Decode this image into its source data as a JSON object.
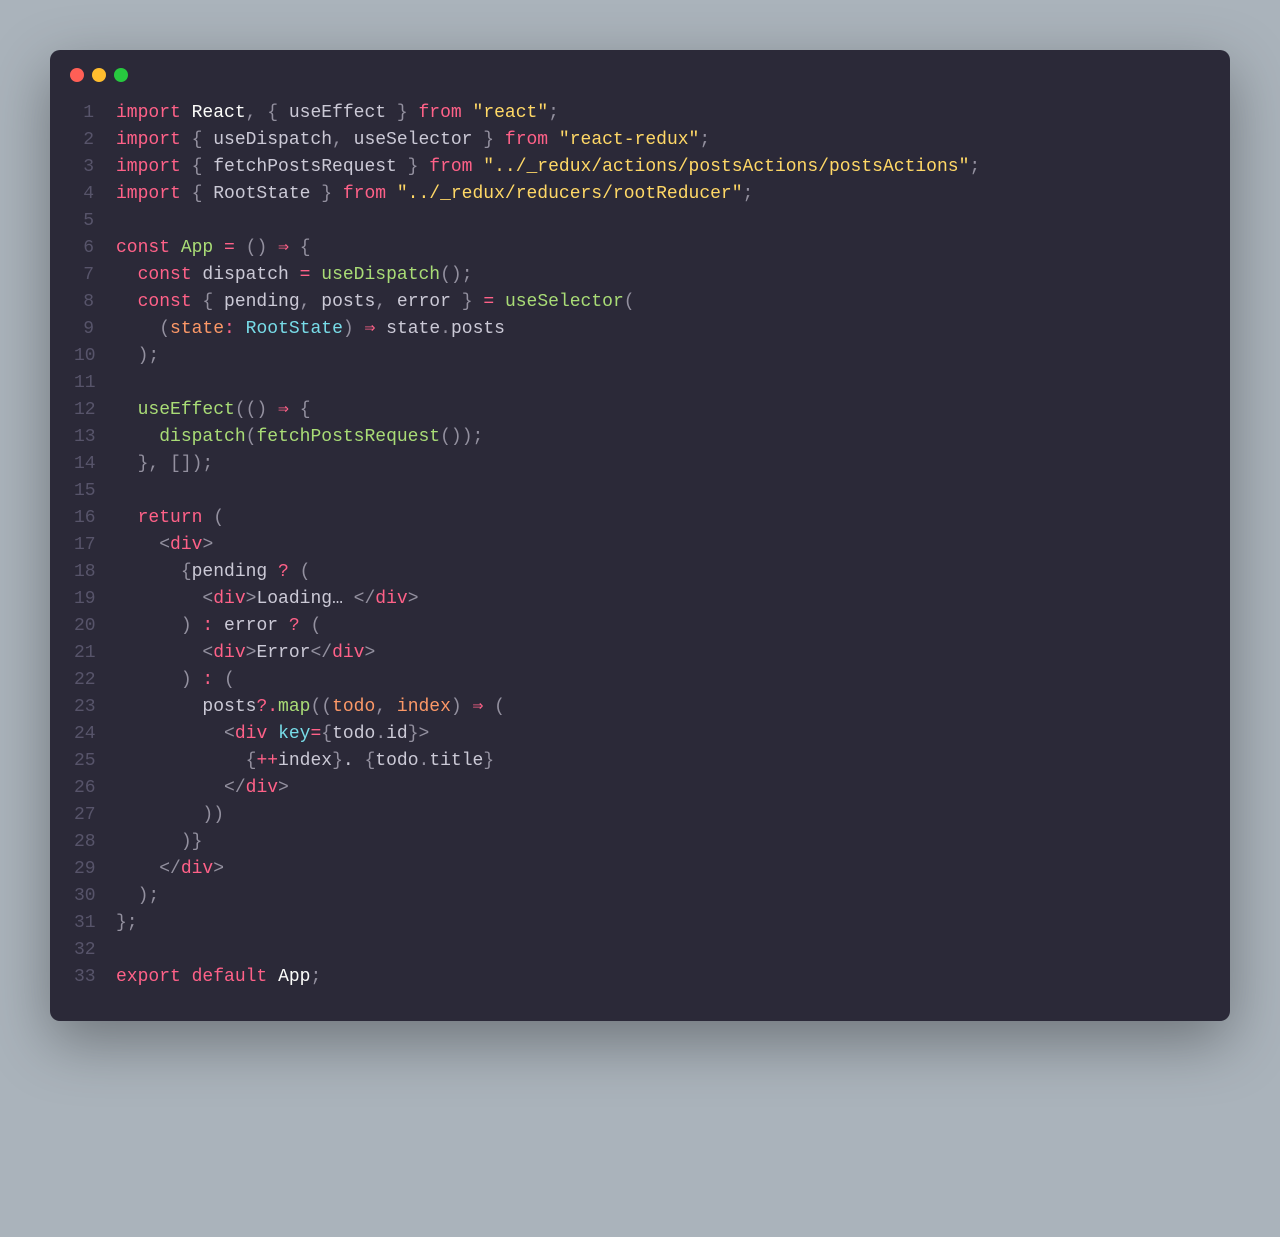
{
  "window": {
    "dots": [
      "red",
      "yellow",
      "green"
    ]
  },
  "colors": {
    "background": "#aab3bb",
    "editor_bg": "#2b2938",
    "gutter": "#57546a",
    "keyword": "#ff6188",
    "string": "#ffd866",
    "func": "#a9dc76",
    "type": "#78dce8",
    "param": "#fc9867",
    "default": "#cbc9d6",
    "punct": "#93909f",
    "white": "#fcfcfa"
  },
  "code": {
    "line_count": 33,
    "lines": [
      {
        "n": 1,
        "tokens": [
          [
            "keyword",
            "import"
          ],
          [
            "default",
            " "
          ],
          [
            "white",
            "React"
          ],
          [
            "punct",
            ", { "
          ],
          [
            "default",
            "useEffect"
          ],
          [
            "punct",
            " } "
          ],
          [
            "keyword",
            "from"
          ],
          [
            "default",
            " "
          ],
          [
            "string",
            "\"react\""
          ],
          [
            "punct",
            ";"
          ]
        ]
      },
      {
        "n": 2,
        "tokens": [
          [
            "keyword",
            "import"
          ],
          [
            "punct",
            " { "
          ],
          [
            "default",
            "useDispatch"
          ],
          [
            "punct",
            ", "
          ],
          [
            "default",
            "useSelector"
          ],
          [
            "punct",
            " } "
          ],
          [
            "keyword",
            "from"
          ],
          [
            "default",
            " "
          ],
          [
            "string",
            "\"react-redux\""
          ],
          [
            "punct",
            ";"
          ]
        ]
      },
      {
        "n": 3,
        "tokens": [
          [
            "keyword",
            "import"
          ],
          [
            "punct",
            " { "
          ],
          [
            "default",
            "fetchPostsRequest"
          ],
          [
            "punct",
            " } "
          ],
          [
            "keyword",
            "from"
          ],
          [
            "default",
            " "
          ],
          [
            "string",
            "\"../_redux/actions/postsActions/postsActions\""
          ],
          [
            "punct",
            ";"
          ]
        ]
      },
      {
        "n": 4,
        "tokens": [
          [
            "keyword",
            "import"
          ],
          [
            "punct",
            " { "
          ],
          [
            "default",
            "RootState"
          ],
          [
            "punct",
            " } "
          ],
          [
            "keyword",
            "from"
          ],
          [
            "default",
            " "
          ],
          [
            "string",
            "\"../_redux/reducers/rootReducer\""
          ],
          [
            "punct",
            ";"
          ]
        ]
      },
      {
        "n": 5,
        "tokens": []
      },
      {
        "n": 6,
        "tokens": [
          [
            "keyword",
            "const"
          ],
          [
            "default",
            " "
          ],
          [
            "func",
            "App"
          ],
          [
            "default",
            " "
          ],
          [
            "op",
            "="
          ],
          [
            "default",
            " "
          ],
          [
            "punct",
            "() "
          ],
          [
            "keyword",
            "⇒"
          ],
          [
            "default",
            " "
          ],
          [
            "punct",
            "{"
          ]
        ]
      },
      {
        "n": 7,
        "tokens": [
          [
            "default",
            "  "
          ],
          [
            "keyword",
            "const"
          ],
          [
            "default",
            " dispatch "
          ],
          [
            "op",
            "="
          ],
          [
            "default",
            " "
          ],
          [
            "func",
            "useDispatch"
          ],
          [
            "punct",
            "();"
          ]
        ]
      },
      {
        "n": 8,
        "tokens": [
          [
            "default",
            "  "
          ],
          [
            "keyword",
            "const"
          ],
          [
            "punct",
            " { "
          ],
          [
            "default",
            "pending"
          ],
          [
            "punct",
            ", "
          ],
          [
            "default",
            "posts"
          ],
          [
            "punct",
            ", "
          ],
          [
            "default",
            "error"
          ],
          [
            "punct",
            " } "
          ],
          [
            "op",
            "="
          ],
          [
            "default",
            " "
          ],
          [
            "func",
            "useSelector"
          ],
          [
            "punct",
            "("
          ]
        ]
      },
      {
        "n": 9,
        "tokens": [
          [
            "default",
            "    "
          ],
          [
            "punct",
            "("
          ],
          [
            "param",
            "state"
          ],
          [
            "op",
            ":"
          ],
          [
            "default",
            " "
          ],
          [
            "type",
            "RootState"
          ],
          [
            "punct",
            ") "
          ],
          [
            "keyword",
            "⇒"
          ],
          [
            "default",
            " state"
          ],
          [
            "punct",
            "."
          ],
          [
            "default",
            "posts"
          ]
        ]
      },
      {
        "n": 10,
        "tokens": [
          [
            "default",
            "  "
          ],
          [
            "punct",
            ");"
          ]
        ]
      },
      {
        "n": 11,
        "tokens": []
      },
      {
        "n": 12,
        "tokens": [
          [
            "default",
            "  "
          ],
          [
            "func",
            "useEffect"
          ],
          [
            "punct",
            "(() "
          ],
          [
            "keyword",
            "⇒"
          ],
          [
            "punct",
            " {"
          ]
        ]
      },
      {
        "n": 13,
        "tokens": [
          [
            "default",
            "    "
          ],
          [
            "func",
            "dispatch"
          ],
          [
            "punct",
            "("
          ],
          [
            "func",
            "fetchPostsRequest"
          ],
          [
            "punct",
            "());"
          ]
        ]
      },
      {
        "n": 14,
        "tokens": [
          [
            "default",
            "  "
          ],
          [
            "punct",
            "}, []);"
          ]
        ]
      },
      {
        "n": 15,
        "tokens": []
      },
      {
        "n": 16,
        "tokens": [
          [
            "default",
            "  "
          ],
          [
            "keyword",
            "return"
          ],
          [
            "default",
            " "
          ],
          [
            "punct",
            "("
          ]
        ]
      },
      {
        "n": 17,
        "tokens": [
          [
            "default",
            "    "
          ],
          [
            "punct",
            "<"
          ],
          [
            "keyword",
            "div"
          ],
          [
            "punct",
            ">"
          ]
        ]
      },
      {
        "n": 18,
        "tokens": [
          [
            "default",
            "      "
          ],
          [
            "punct",
            "{"
          ],
          [
            "default",
            "pending "
          ],
          [
            "op",
            "?"
          ],
          [
            "default",
            " "
          ],
          [
            "punct",
            "("
          ]
        ]
      },
      {
        "n": 19,
        "tokens": [
          [
            "default",
            "        "
          ],
          [
            "punct",
            "<"
          ],
          [
            "keyword",
            "div"
          ],
          [
            "punct",
            ">"
          ],
          [
            "default",
            "Loading… "
          ],
          [
            "punct",
            "</"
          ],
          [
            "keyword",
            "div"
          ],
          [
            "punct",
            ">"
          ]
        ]
      },
      {
        "n": 20,
        "tokens": [
          [
            "default",
            "      "
          ],
          [
            "punct",
            ") "
          ],
          [
            "op",
            ":"
          ],
          [
            "default",
            " error "
          ],
          [
            "op",
            "?"
          ],
          [
            "default",
            " "
          ],
          [
            "punct",
            "("
          ]
        ]
      },
      {
        "n": 21,
        "tokens": [
          [
            "default",
            "        "
          ],
          [
            "punct",
            "<"
          ],
          [
            "keyword",
            "div"
          ],
          [
            "punct",
            ">"
          ],
          [
            "default",
            "Error"
          ],
          [
            "punct",
            "</"
          ],
          [
            "keyword",
            "div"
          ],
          [
            "punct",
            ">"
          ]
        ]
      },
      {
        "n": 22,
        "tokens": [
          [
            "default",
            "      "
          ],
          [
            "punct",
            ") "
          ],
          [
            "op",
            ":"
          ],
          [
            "default",
            " "
          ],
          [
            "punct",
            "("
          ]
        ]
      },
      {
        "n": 23,
        "tokens": [
          [
            "default",
            "        posts"
          ],
          [
            "op",
            "?."
          ],
          [
            "func",
            "map"
          ],
          [
            "punct",
            "(("
          ],
          [
            "param",
            "todo"
          ],
          [
            "punct",
            ", "
          ],
          [
            "param",
            "index"
          ],
          [
            "punct",
            ") "
          ],
          [
            "keyword",
            "⇒"
          ],
          [
            "default",
            " "
          ],
          [
            "punct",
            "("
          ]
        ]
      },
      {
        "n": 24,
        "tokens": [
          [
            "default",
            "          "
          ],
          [
            "punct",
            "<"
          ],
          [
            "keyword",
            "div"
          ],
          [
            "default",
            " "
          ],
          [
            "attr",
            "key"
          ],
          [
            "op",
            "="
          ],
          [
            "punct",
            "{"
          ],
          [
            "default",
            "todo"
          ],
          [
            "punct",
            "."
          ],
          [
            "default",
            "id"
          ],
          [
            "punct",
            "}>"
          ]
        ]
      },
      {
        "n": 25,
        "tokens": [
          [
            "default",
            "            "
          ],
          [
            "punct",
            "{"
          ],
          [
            "op",
            "++"
          ],
          [
            "default",
            "index"
          ],
          [
            "punct",
            "}"
          ],
          [
            "default",
            ". "
          ],
          [
            "punct",
            "{"
          ],
          [
            "default",
            "todo"
          ],
          [
            "punct",
            "."
          ],
          [
            "default",
            "title"
          ],
          [
            "punct",
            "}"
          ]
        ]
      },
      {
        "n": 26,
        "tokens": [
          [
            "default",
            "          "
          ],
          [
            "punct",
            "</"
          ],
          [
            "keyword",
            "div"
          ],
          [
            "punct",
            ">"
          ]
        ]
      },
      {
        "n": 27,
        "tokens": [
          [
            "default",
            "        "
          ],
          [
            "punct",
            "))"
          ]
        ]
      },
      {
        "n": 28,
        "tokens": [
          [
            "default",
            "      "
          ],
          [
            "punct",
            ")}"
          ]
        ]
      },
      {
        "n": 29,
        "tokens": [
          [
            "default",
            "    "
          ],
          [
            "punct",
            "</"
          ],
          [
            "keyword",
            "div"
          ],
          [
            "punct",
            ">"
          ]
        ]
      },
      {
        "n": 30,
        "tokens": [
          [
            "default",
            "  "
          ],
          [
            "punct",
            ");"
          ]
        ]
      },
      {
        "n": 31,
        "tokens": [
          [
            "punct",
            "};"
          ]
        ]
      },
      {
        "n": 32,
        "tokens": []
      },
      {
        "n": 33,
        "tokens": [
          [
            "keyword",
            "export"
          ],
          [
            "default",
            " "
          ],
          [
            "keyword",
            "default"
          ],
          [
            "default",
            " "
          ],
          [
            "white",
            "App"
          ],
          [
            "punct",
            ";"
          ]
        ]
      }
    ]
  }
}
